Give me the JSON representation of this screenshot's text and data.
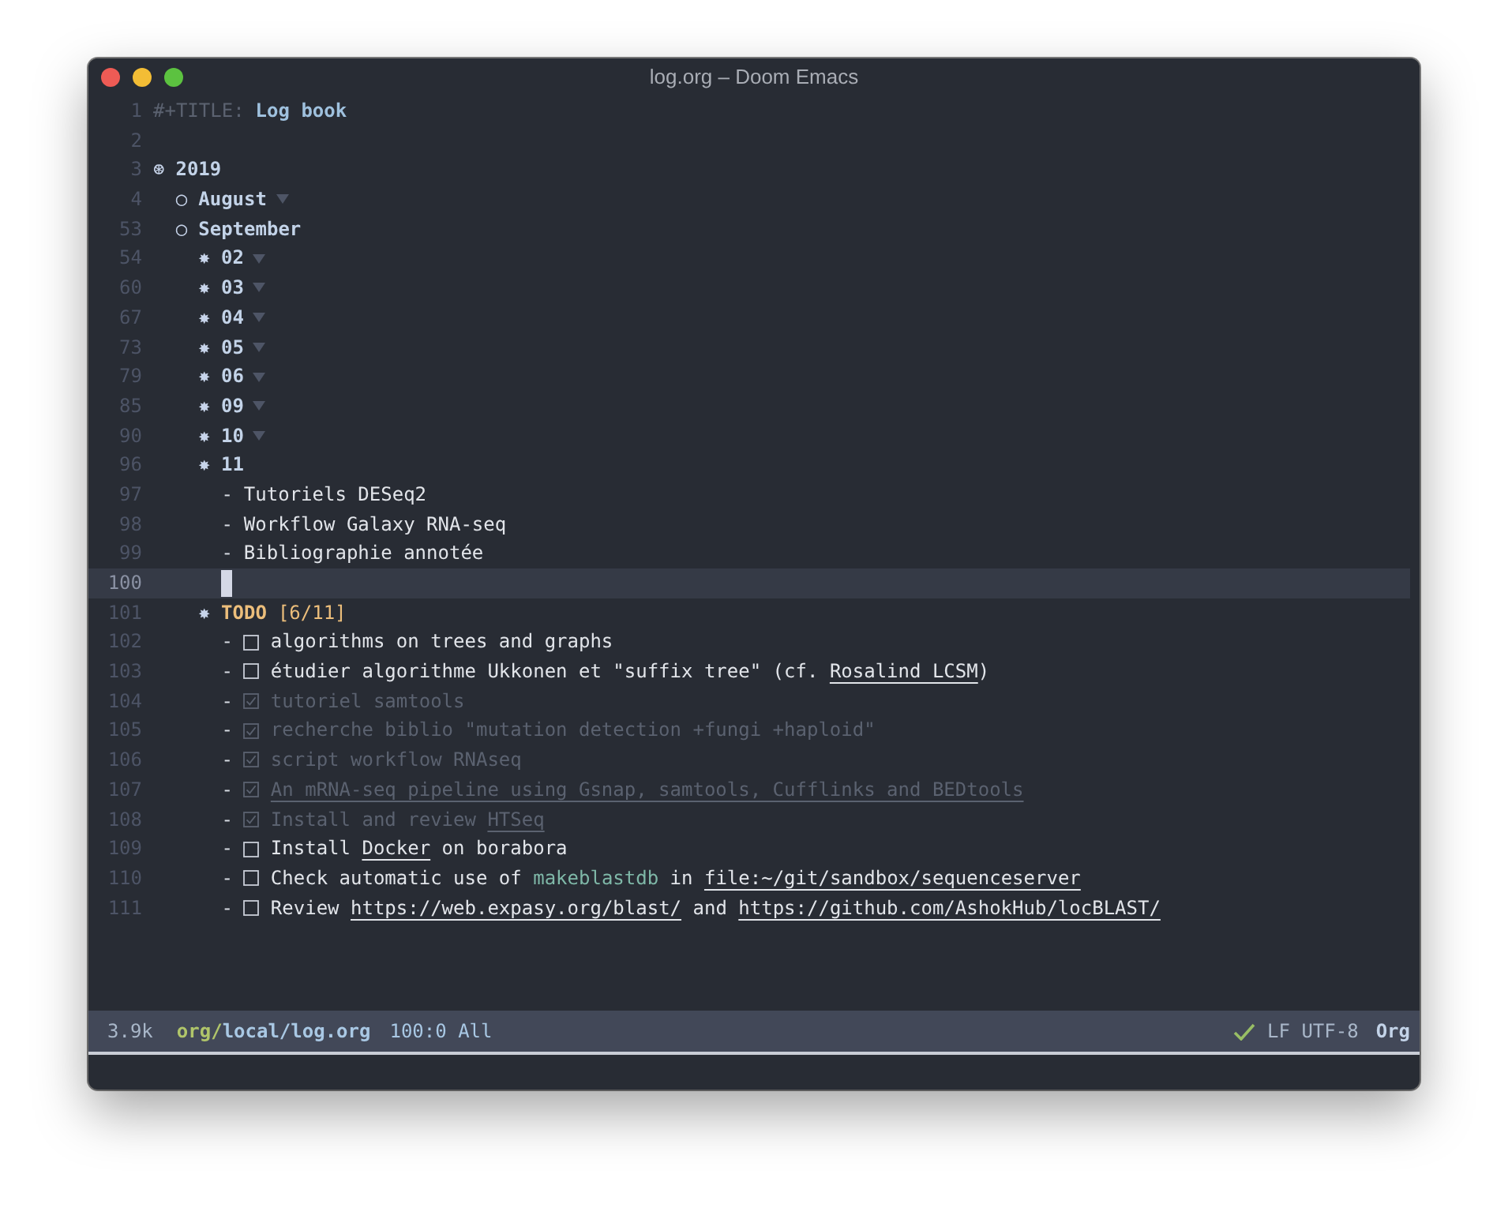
{
  "window": {
    "title": "log.org – Doom Emacs"
  },
  "buffer": [
    {
      "number": "1",
      "kind": "keyword",
      "keyword": "#+TITLE:",
      "text": "Log book"
    },
    {
      "number": "2",
      "kind": "blank"
    },
    {
      "number": "3",
      "kind": "heading",
      "bullet": "⊛",
      "text": "2019",
      "folded": false,
      "children": [
        {
          "number": "4",
          "kind": "heading",
          "bullet": "○",
          "text": "August",
          "folded": true
        },
        {
          "number": "53",
          "kind": "heading",
          "bullet": "○",
          "text": "September",
          "folded": false,
          "children": [
            {
              "number": "54",
              "kind": "heading",
              "bullet": "✸",
              "text": "02",
              "folded": true
            },
            {
              "number": "60",
              "kind": "heading",
              "bullet": "✸",
              "text": "03",
              "folded": true
            },
            {
              "number": "67",
              "kind": "heading",
              "bullet": "✸",
              "text": "04",
              "folded": true
            },
            {
              "number": "73",
              "kind": "heading",
              "bullet": "✸",
              "text": "05",
              "folded": true
            },
            {
              "number": "79",
              "kind": "heading",
              "bullet": "✸",
              "text": "06",
              "folded": true
            },
            {
              "number": "85",
              "kind": "heading",
              "bullet": "✸",
              "text": "09",
              "folded": true
            },
            {
              "number": "90",
              "kind": "heading",
              "bullet": "✸",
              "text": "10",
              "folded": true
            },
            {
              "number": "96",
              "kind": "heading",
              "bullet": "✸",
              "text": "11",
              "folded": false,
              "children": [
                {
                  "number": "97",
                  "kind": "item",
                  "dash": "-",
                  "parts": [
                    {
                      "kind": "plain",
                      "text": "Tutoriels DESeq2"
                    }
                  ]
                },
                {
                  "number": "98",
                  "kind": "item",
                  "dash": "-",
                  "parts": [
                    {
                      "kind": "plain",
                      "text": "Workflow Galaxy RNA-seq"
                    }
                  ]
                },
                {
                  "number": "99",
                  "kind": "item",
                  "dash": "-",
                  "parts": [
                    {
                      "kind": "plain",
                      "text": "Bibliographie annotée"
                    }
                  ]
                },
                {
                  "number": "100",
                  "kind": "cursor"
                }
              ]
            },
            {
              "number": "101",
              "kind": "todo",
              "bullet": "✸",
              "keyword": "TODO",
              "progress": "[6/11]",
              "folded": false,
              "children": [
                {
                  "number": "102",
                  "kind": "check",
                  "dash": "-",
                  "checked": false,
                  "parts": [
                    {
                      "kind": "plain",
                      "text": "algorithms on trees and graphs"
                    }
                  ]
                },
                {
                  "number": "103",
                  "kind": "check",
                  "dash": "-",
                  "checked": false,
                  "parts": [
                    {
                      "kind": "plain",
                      "text": "étudier algorithme Ukkonen et \"suffix tree\" (cf. "
                    },
                    {
                      "kind": "link",
                      "text": "Rosalind LCSM"
                    },
                    {
                      "kind": "plain",
                      "text": ")"
                    }
                  ]
                },
                {
                  "number": "104",
                  "kind": "check",
                  "dash": "-",
                  "checked": true,
                  "parts": [
                    {
                      "kind": "plain",
                      "text": "tutoriel samtools"
                    }
                  ]
                },
                {
                  "number": "105",
                  "kind": "check",
                  "dash": "-",
                  "checked": true,
                  "parts": [
                    {
                      "kind": "plain",
                      "text": "recherche biblio \"mutation detection +fungi +haploid\""
                    }
                  ]
                },
                {
                  "number": "106",
                  "kind": "check",
                  "dash": "-",
                  "checked": true,
                  "parts": [
                    {
                      "kind": "plain",
                      "text": "script workflow RNAseq"
                    }
                  ]
                },
                {
                  "number": "107",
                  "kind": "check",
                  "dash": "-",
                  "checked": true,
                  "parts": [
                    {
                      "kind": "link",
                      "text": "An mRNA-seq pipeline using Gsnap, samtools, Cufflinks and BEDtools"
                    }
                  ]
                },
                {
                  "number": "108",
                  "kind": "check",
                  "dash": "-",
                  "checked": true,
                  "parts": [
                    {
                      "kind": "plain",
                      "text": "Install and review "
                    },
                    {
                      "kind": "link",
                      "text": "HTSeq"
                    }
                  ]
                },
                {
                  "number": "109",
                  "kind": "check",
                  "dash": "-",
                  "checked": false,
                  "parts": [
                    {
                      "kind": "plain",
                      "text": "Install "
                    },
                    {
                      "kind": "link",
                      "text": "Docker"
                    },
                    {
                      "kind": "plain",
                      "text": " on borabora"
                    }
                  ]
                },
                {
                  "number": "110",
                  "kind": "check",
                  "dash": "-",
                  "checked": false,
                  "parts": [
                    {
                      "kind": "plain",
                      "text": "Check automatic use of "
                    },
                    {
                      "kind": "code",
                      "text": "makeblastdb"
                    },
                    {
                      "kind": "plain",
                      "text": " in "
                    },
                    {
                      "kind": "link",
                      "text": "file:~/git/sandbox/sequenceserver"
                    }
                  ]
                },
                {
                  "number": "111",
                  "kind": "check",
                  "dash": "-",
                  "checked": false,
                  "parts": [
                    {
                      "kind": "plain",
                      "text": "Review "
                    },
                    {
                      "kind": "link",
                      "text": "https://web.expasy.org/blast/"
                    },
                    {
                      "kind": "plain",
                      "text": " and "
                    },
                    {
                      "kind": "link",
                      "text": "https://github.com/AshokHub/locBLAST/"
                    }
                  ]
                }
              ]
            }
          ]
        }
      ]
    }
  ],
  "status_bar": {
    "size": "3.9k",
    "buffer_dir": "org/",
    "buffer_name": "local/log.org",
    "position": "100:0 All",
    "checker_ok": true,
    "encoding": "LF UTF-8",
    "mode": "Org"
  }
}
